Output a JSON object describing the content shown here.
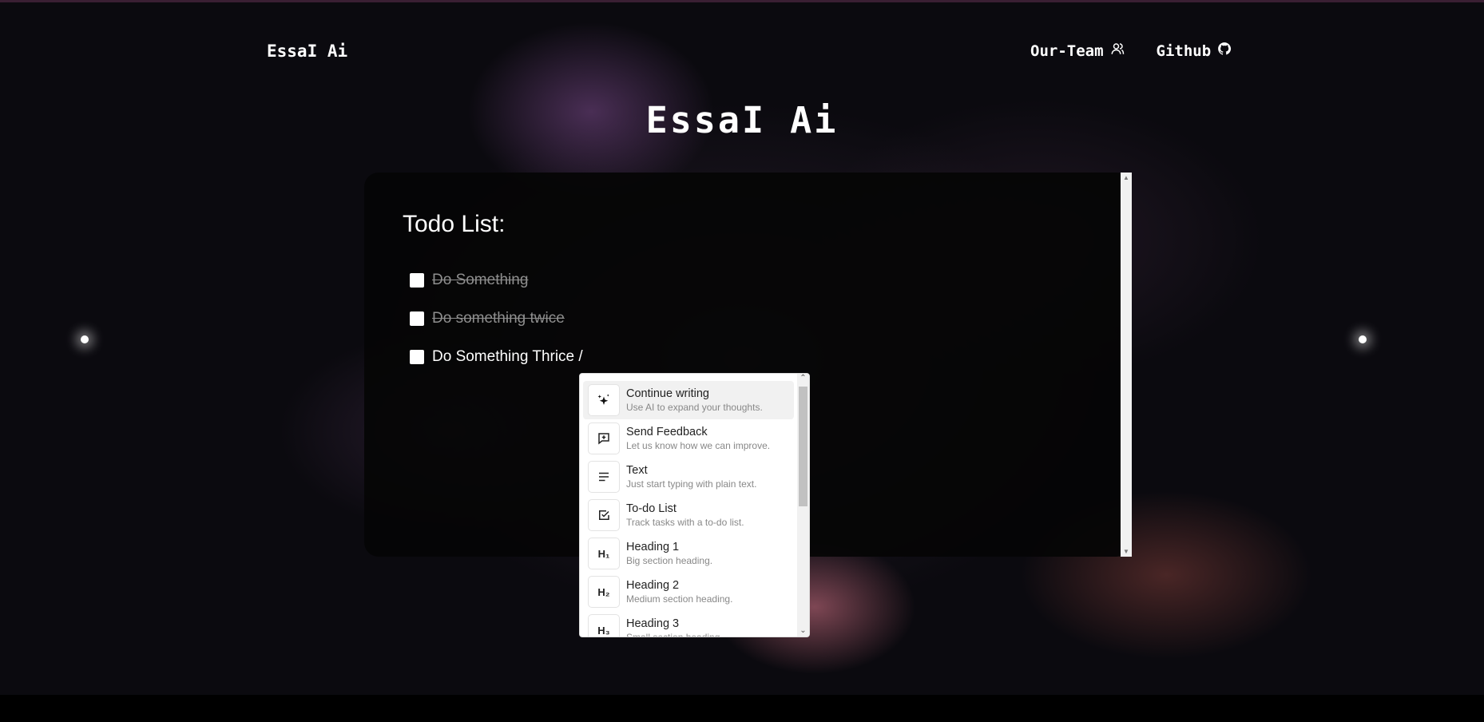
{
  "nav": {
    "brand": "EssaI Ai",
    "links": [
      {
        "label": "Our-Team",
        "icon": "team-icon"
      },
      {
        "label": "Github",
        "icon": "github-icon"
      }
    ]
  },
  "hero": {
    "title": "EssaI Ai"
  },
  "editor": {
    "heading": "Todo List:",
    "todos": [
      {
        "text": "Do Something",
        "checked": false,
        "strikethrough": true
      },
      {
        "text": "Do something twice",
        "checked": false,
        "strikethrough": true
      },
      {
        "text": "Do Something Thrice /",
        "checked": false,
        "strikethrough": false
      }
    ]
  },
  "slash_menu": {
    "items": [
      {
        "title": "Continue writing",
        "description": "Use AI to expand your thoughts.",
        "icon": "sparkles-icon",
        "active": true
      },
      {
        "title": "Send Feedback",
        "description": "Let us know how we can improve.",
        "icon": "feedback-icon"
      },
      {
        "title": "Text",
        "description": "Just start typing with plain text.",
        "icon": "text-icon"
      },
      {
        "title": "To-do List",
        "description": "Track tasks with a to-do list.",
        "icon": "checkbox-icon"
      },
      {
        "title": "Heading 1",
        "description": "Big section heading.",
        "icon": "heading1-icon",
        "icon_text": "H₁"
      },
      {
        "title": "Heading 2",
        "description": "Medium section heading.",
        "icon": "heading2-icon",
        "icon_text": "H₂"
      },
      {
        "title": "Heading 3",
        "description": "Small section heading.",
        "icon": "heading3-icon",
        "icon_text": "H₃"
      }
    ]
  }
}
